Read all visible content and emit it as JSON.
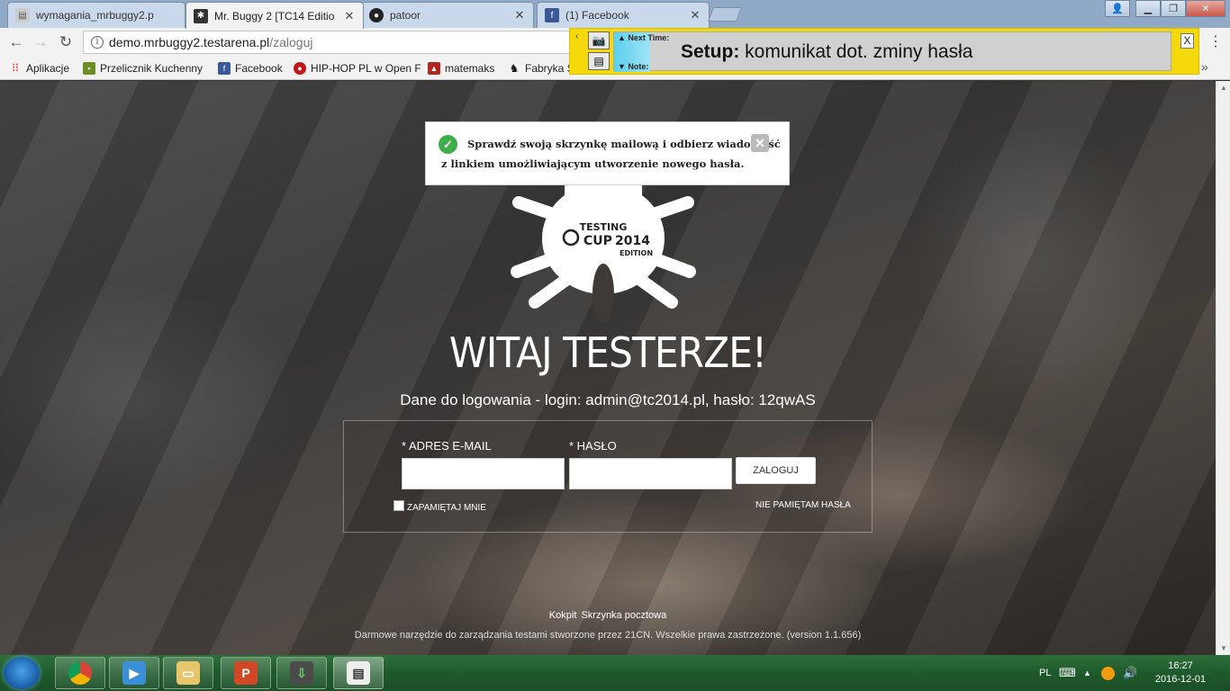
{
  "browser": {
    "tabs": [
      {
        "title": "wymagania_mrbuggy2.p",
        "active": false,
        "favicon": "document-icon"
      },
      {
        "title": "Mr. Buggy 2 [TC14 Editio",
        "active": true,
        "favicon": "bug-icon"
      },
      {
        "title": "patoor",
        "active": false,
        "favicon": "github-icon"
      },
      {
        "title": "(1) Facebook",
        "active": false,
        "favicon": "facebook-icon"
      }
    ],
    "url_host": "demo.mrbuggy2.testarena.pl",
    "url_path": "/zaloguj",
    "bookmarks": [
      {
        "label": "Aplikacje",
        "icon": "apps-grid-icon"
      },
      {
        "label": "Przelicznik Kuchenny",
        "icon": "bookmark-green-icon"
      },
      {
        "label": "Facebook",
        "icon": "facebook-icon"
      },
      {
        "label": "HIP-HOP PL w Open F",
        "icon": "record-icon"
      },
      {
        "label": "matemaks",
        "icon": "matemaks-icon"
      },
      {
        "label": "Fabryka S",
        "icon": "fabryka-icon"
      }
    ]
  },
  "widget": {
    "next_time_label": "▲ Next Time:",
    "note_label": "▼ Note:",
    "setup_bold": "Setup:",
    "setup_text": " komunikat dot. zminy hasła",
    "close_label": "X"
  },
  "notice": {
    "line1": "Sprawdź swoją skrzynkę mailową i odbierz wiadomość",
    "line2": "z linkiem umożliwiającym utworzenie nowego hasła."
  },
  "logo": {
    "line1": "TESTING",
    "line2": "CUP",
    "year": "2014",
    "line3": "EDITION"
  },
  "page": {
    "welcome": "WITAJ TESTERZE!",
    "credentials": "Dane do logowania - login: admin@tc2014.pl, hasło: 12qwAS"
  },
  "login_form": {
    "email_label": "* ADRES E-MAIL",
    "password_label": "* HASŁO",
    "email_value": "",
    "password_value": "",
    "submit_label": "ZALOGUJ",
    "remember_label": "ZAPAMIĘTAJ MNIE",
    "forgot_label": "NIE PAMIĘTAM HASŁA"
  },
  "footer": {
    "links": [
      "Kokpit",
      "Skrzynka pocztowa"
    ],
    "copyright": "Darmowe narzędzie do zarządzania testami stworzone przez 21CN. Wszelkie prawa zastrzeżone. (version 1.1.656)"
  },
  "taskbar": {
    "language": "PL",
    "time": "16:27",
    "date": "2016-12-01"
  }
}
